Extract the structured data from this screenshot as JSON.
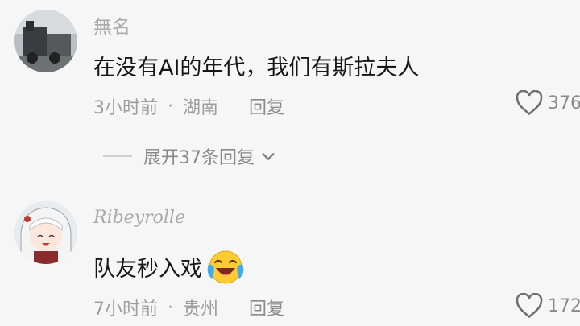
{
  "comments": [
    {
      "username": "無名",
      "content": "在没有AI的年代，我们有斯拉夫人",
      "time": "3小时前",
      "separator": "·",
      "location": "湖南",
      "reply_label": "回复",
      "likes": "376",
      "expand_label": "展开37条回复",
      "avatar_icon": "train-photo-avatar"
    },
    {
      "username": "Ribeyrolle",
      "content": "队友秒入戏",
      "emoji": "laughing-crying-emoji",
      "time": "7小时前",
      "separator": "·",
      "location": "贵州",
      "reply_label": "回复",
      "likes": "172",
      "avatar_icon": "anime-girl-avatar"
    }
  ],
  "colors": {
    "background": "#f6f6f6",
    "text": "#161616",
    "meta": "#9d9d9d"
  }
}
